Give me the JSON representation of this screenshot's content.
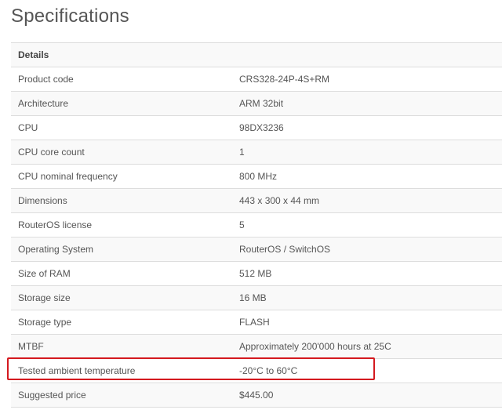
{
  "page": {
    "title": "Specifications"
  },
  "table": {
    "section_header": "Details",
    "rows": [
      {
        "label": "Product code",
        "value": "CRS328-24P-4S+RM"
      },
      {
        "label": "Architecture",
        "value": "ARM 32bit"
      },
      {
        "label": "CPU",
        "value": "98DX3236"
      },
      {
        "label": "CPU core count",
        "value": "1"
      },
      {
        "label": "CPU nominal frequency",
        "value": "800 MHz"
      },
      {
        "label": "Dimensions",
        "value": "443 x 300 x 44 mm"
      },
      {
        "label": "RouterOS license",
        "value": "5"
      },
      {
        "label": "Operating System",
        "value": "RouterOS / SwitchOS"
      },
      {
        "label": "Size of RAM",
        "value": "512 MB"
      },
      {
        "label": "Storage size",
        "value": "16 MB"
      },
      {
        "label": "Storage type",
        "value": "FLASH"
      },
      {
        "label": "MTBF",
        "value": "Approximately 200'000 hours at 25C"
      },
      {
        "label": "Tested ambient temperature",
        "value": "-20°C to 60°C"
      },
      {
        "label": "Suggested price",
        "value": "$445.00"
      }
    ]
  },
  "annotation": {
    "highlight_color": "#d4191f"
  },
  "colors": {
    "text": "#555555",
    "stripe": "#f9f9f9",
    "border": "#dddddd"
  }
}
